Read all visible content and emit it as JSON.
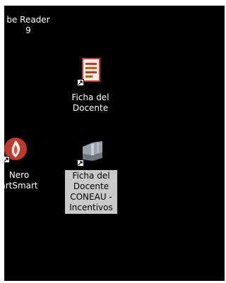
{
  "icons": [
    {
      "id": "reader",
      "lines": [
        "be Reader",
        "9"
      ],
      "selected": false
    },
    {
      "id": "ficha",
      "lines": [
        "Ficha del",
        "Docente"
      ],
      "selected": false
    },
    {
      "id": "nero",
      "lines": [
        "Nero",
        "artSmart"
      ],
      "selected": false
    },
    {
      "id": "coneau",
      "lines": [
        "Ficha del",
        "Docente",
        "CONEAU -",
        "Incentivos"
      ],
      "selected": true
    }
  ]
}
